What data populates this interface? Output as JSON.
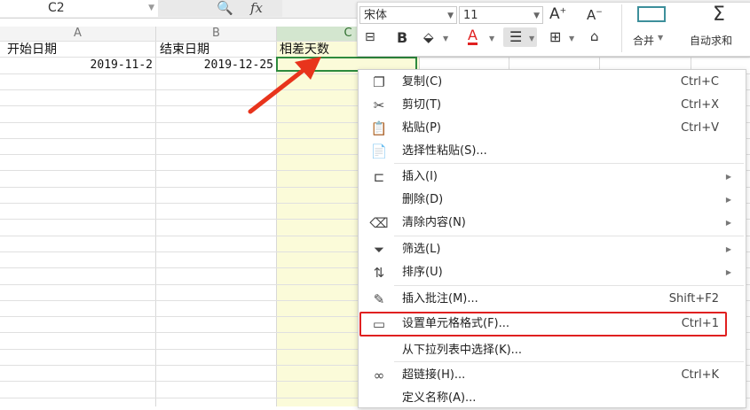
{
  "namebox": {
    "value": "C2"
  },
  "formula_bar": {
    "zoom_icon": "search-zoom-icon",
    "fx_label": "fx"
  },
  "columns": [
    {
      "label": "A"
    },
    {
      "label": "B"
    },
    {
      "label": "C"
    }
  ],
  "cells": {
    "a1": "开始日期",
    "b1": "结束日期",
    "c1": "相差天数",
    "a2": "2019-11-2",
    "b2": "2019-12-25"
  },
  "ribbon": {
    "font_name": "宋体",
    "font_size": "11",
    "merge_label": "合并",
    "autosum_label": "自动求和"
  },
  "context_menu": {
    "items": [
      {
        "label": "复制(C)",
        "shortcut": "Ctrl+C",
        "icon": "copy-icon"
      },
      {
        "label": "剪切(T)",
        "shortcut": "Ctrl+X",
        "icon": "cut-icon"
      },
      {
        "label": "粘贴(P)",
        "shortcut": "Ctrl+V",
        "icon": "paste-icon"
      },
      {
        "label": "选择性粘贴(S)...",
        "shortcut": "",
        "icon": "paste-special-icon"
      },
      {
        "label": "插入(I)",
        "shortcut": "",
        "icon": "insert-icon"
      },
      {
        "label": "删除(D)",
        "shortcut": "",
        "icon": ""
      },
      {
        "label": "清除内容(N)",
        "shortcut": "",
        "icon": "eraser-icon"
      },
      {
        "label": "筛选(L)",
        "shortcut": "",
        "icon": "filter-icon"
      },
      {
        "label": "排序(U)",
        "shortcut": "",
        "icon": "sort-icon"
      },
      {
        "label": "插入批注(M)...",
        "shortcut": "Shift+F2",
        "icon": "comment-icon"
      },
      {
        "label": "设置单元格格式(F)...",
        "shortcut": "Ctrl+1",
        "icon": "format-cells-icon"
      },
      {
        "label": "从下拉列表中选择(K)...",
        "shortcut": "",
        "icon": ""
      },
      {
        "label": "超链接(H)...",
        "shortcut": "Ctrl+K",
        "icon": "hyperlink-icon"
      },
      {
        "label": "定义名称(A)...",
        "shortcut": "",
        "icon": ""
      }
    ]
  },
  "colors": {
    "accent": "#2e8b3e",
    "highlight": "#e02020",
    "arrow": "#e8341c",
    "selected_column": "#fbfbd9"
  }
}
